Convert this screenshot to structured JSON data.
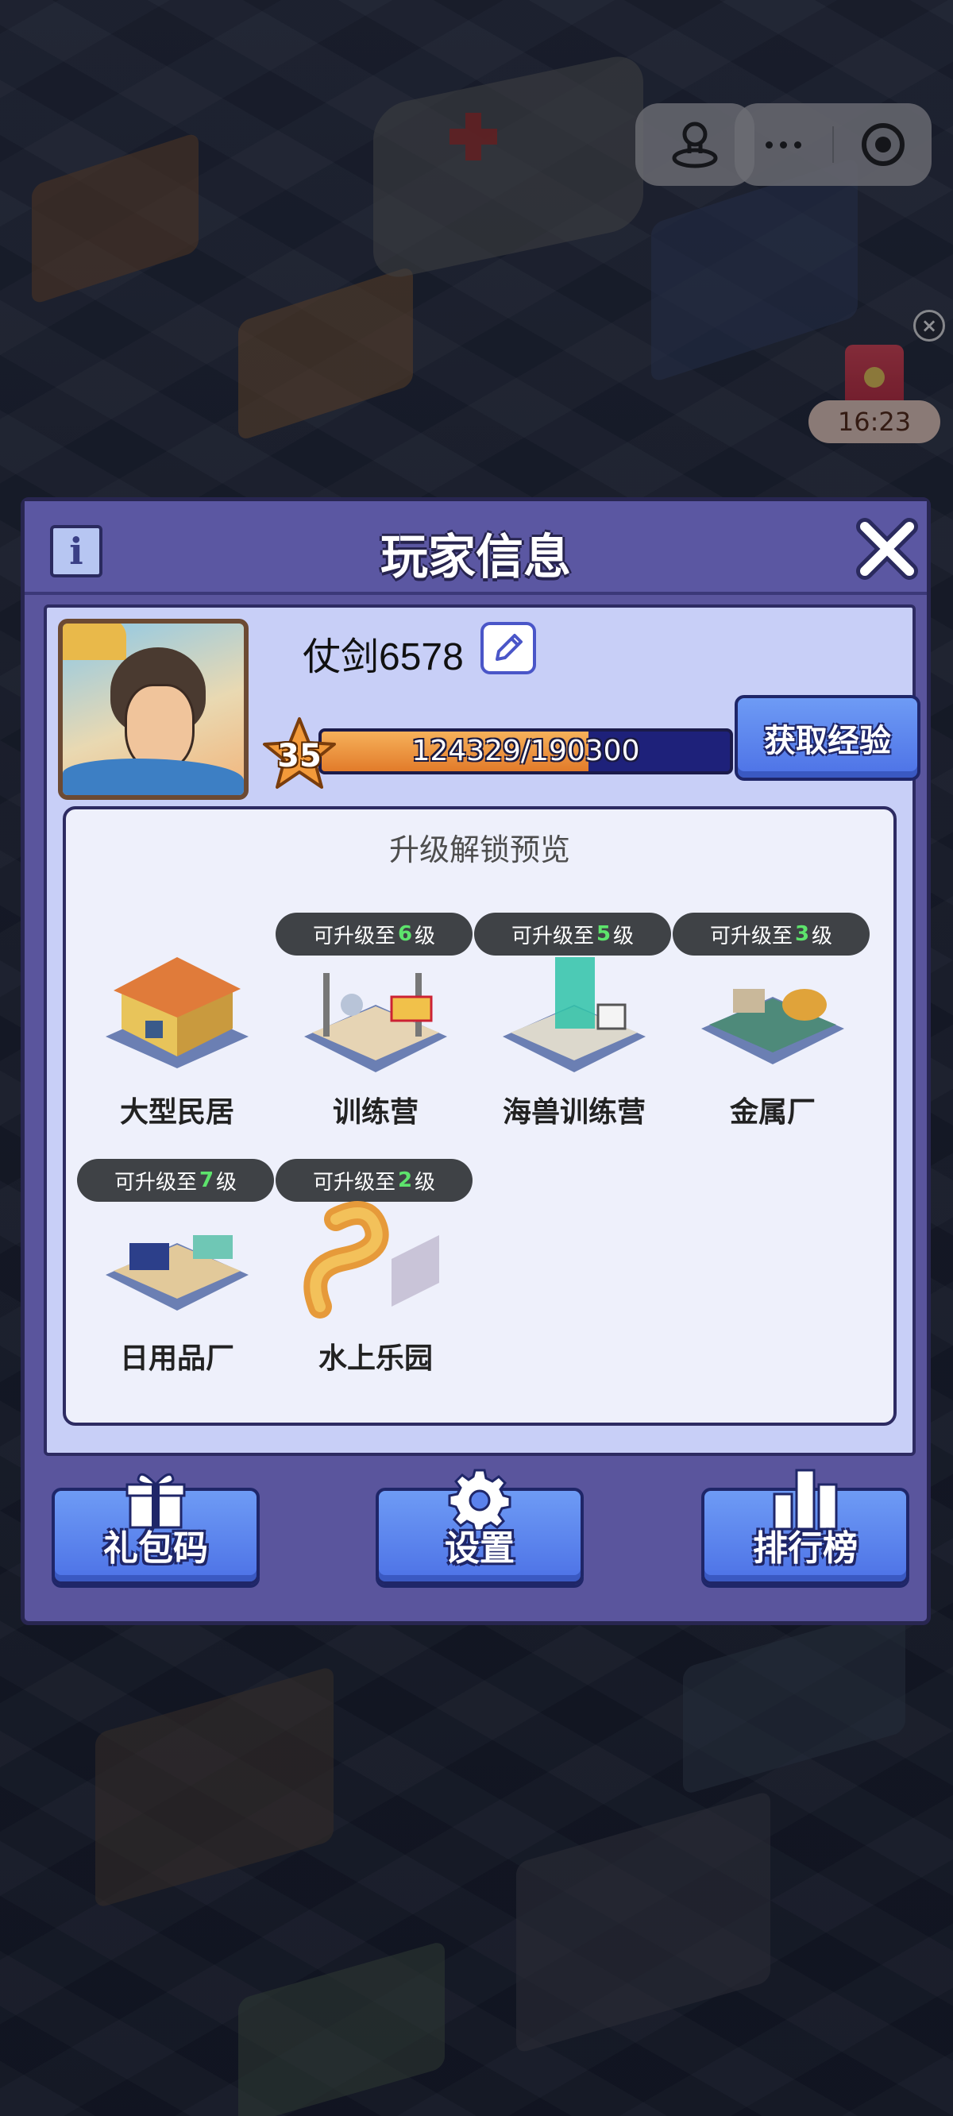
{
  "system": {
    "timer": "16:23"
  },
  "dialog": {
    "title": "玩家信息",
    "player": {
      "name": "仗剑6578",
      "level": "35",
      "exp_text": "124329/190300",
      "exp_progress": 0.653
    },
    "get_exp_label": "获取经验",
    "preview": {
      "title": "升级解锁预览",
      "badge_prefix": "可升级至",
      "badge_suffix": "级",
      "buildings": [
        {
          "name": "大型民居",
          "upgrade_level": null
        },
        {
          "name": "训练营",
          "upgrade_level": "6"
        },
        {
          "name": "海兽训练营",
          "upgrade_level": "5"
        },
        {
          "name": "金属厂",
          "upgrade_level": "3"
        },
        {
          "name": "日用品厂",
          "upgrade_level": "7"
        },
        {
          "name": "水上乐园",
          "upgrade_level": "2"
        }
      ]
    },
    "buttons": {
      "gift_code": "礼包码",
      "settings": "设置",
      "leaderboard": "排行榜"
    }
  },
  "colors": {
    "dialog_bg": "#5a559d",
    "panel_bg": "#c8cff7",
    "button_blue": "#5b82ec",
    "exp_fill": "#ee9540",
    "badge_level": "#5de36c"
  }
}
